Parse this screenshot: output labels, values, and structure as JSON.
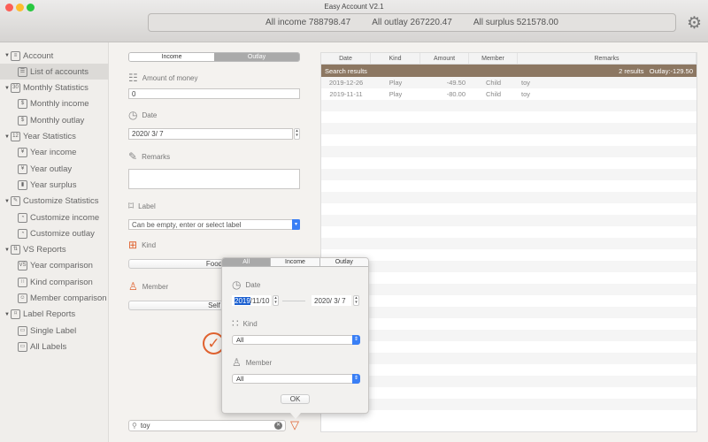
{
  "window": {
    "title": "Easy Account V2.1"
  },
  "summary": {
    "income": "All income 788798.47",
    "outlay": "All outlay 267220.47",
    "surplus": "All surplus 521578.00"
  },
  "sidebar": {
    "items": [
      {
        "label": "Account",
        "level": 0,
        "icon": "list-icon",
        "glyph": "≡"
      },
      {
        "label": "List of accounts",
        "level": 1,
        "icon": "list-icon",
        "glyph": "☰",
        "selected": true
      },
      {
        "label": "Monthly Statistics",
        "level": 0,
        "icon": "calendar-30-icon",
        "glyph": "30"
      },
      {
        "label": "Monthly income",
        "level": 1,
        "icon": "coins-icon",
        "glyph": "$"
      },
      {
        "label": "Monthly outlay",
        "level": 1,
        "icon": "coins-icon",
        "glyph": "$"
      },
      {
        "label": "Year Statistics",
        "level": 0,
        "icon": "calendar-12-icon",
        "glyph": "12"
      },
      {
        "label": "Year income",
        "level": 1,
        "icon": "coin-icon",
        "glyph": "¥"
      },
      {
        "label": "Year outlay",
        "level": 1,
        "icon": "coin-icon",
        "glyph": "¥"
      },
      {
        "label": "Year surplus",
        "level": 1,
        "icon": "bar-chart-icon",
        "glyph": "▮"
      },
      {
        "label": "Customize Statistics",
        "level": 0,
        "icon": "edit-chart-icon",
        "glyph": "✎"
      },
      {
        "label": "Customize income",
        "level": 1,
        "icon": "pie-chart-icon",
        "glyph": "◔"
      },
      {
        "label": "Customize outlay",
        "level": 1,
        "icon": "pie-chart-icon",
        "glyph": "◔"
      },
      {
        "label": "VS Reports",
        "level": 0,
        "icon": "compare-icon",
        "glyph": "⇅"
      },
      {
        "label": "Year comparison",
        "level": 1,
        "icon": "vs-icon",
        "glyph": "VS"
      },
      {
        "label": "Kind comparison",
        "level": 1,
        "icon": "grid-icon",
        "glyph": "∷"
      },
      {
        "label": "Member comparison",
        "level": 1,
        "icon": "people-icon",
        "glyph": "☺"
      },
      {
        "label": "Label Reports",
        "level": 0,
        "icon": "bookmark-icon",
        "glyph": "⌑"
      },
      {
        "label": "Single Label",
        "level": 1,
        "icon": "label-icon",
        "glyph": "▭"
      },
      {
        "label": "All Labels",
        "level": 1,
        "icon": "labels-icon",
        "glyph": "▭"
      }
    ]
  },
  "form": {
    "tabs": [
      "Income",
      "Outlay"
    ],
    "active_tab": "Outlay",
    "amount_label": "Amount of money",
    "amount_value": "0",
    "date_label": "Date",
    "date_value": "2020/  3/  7",
    "remarks_label": "Remarks",
    "remarks_value": "",
    "label_label": "Label",
    "label_placeholder": "Can be empty, enter or select label",
    "kind_label": "Kind",
    "kind_value": "Food",
    "member_label": "Member",
    "member_value": "Self"
  },
  "search": {
    "value": "toy"
  },
  "table": {
    "columns": [
      "Date",
      "Kind",
      "Amount",
      "Member",
      "Remarks"
    ],
    "banner_left": "Search results",
    "banner_count": "2 results",
    "banner_total": "Outlay:-129.50",
    "rows": [
      [
        "2019-12-26",
        "Play",
        "-49.50",
        "Child",
        "toy"
      ],
      [
        "2019-11-11",
        "Play",
        "-80.00",
        "Child",
        "toy"
      ]
    ]
  },
  "filter": {
    "tabs": [
      "All",
      "Income",
      "Outlay"
    ],
    "active_tab": "All",
    "date_label": "Date",
    "date_from_year": "2019",
    "date_from_rest": "/11/10",
    "date_to": "2020/  3/  7",
    "kind_label": "Kind",
    "kind_value": "All",
    "member_label": "Member",
    "member_value": "All",
    "ok_label": "OK"
  },
  "colors": {
    "accent": "#e0622f",
    "banner": "#8c7762",
    "select_blue": "#3a7ff5"
  }
}
